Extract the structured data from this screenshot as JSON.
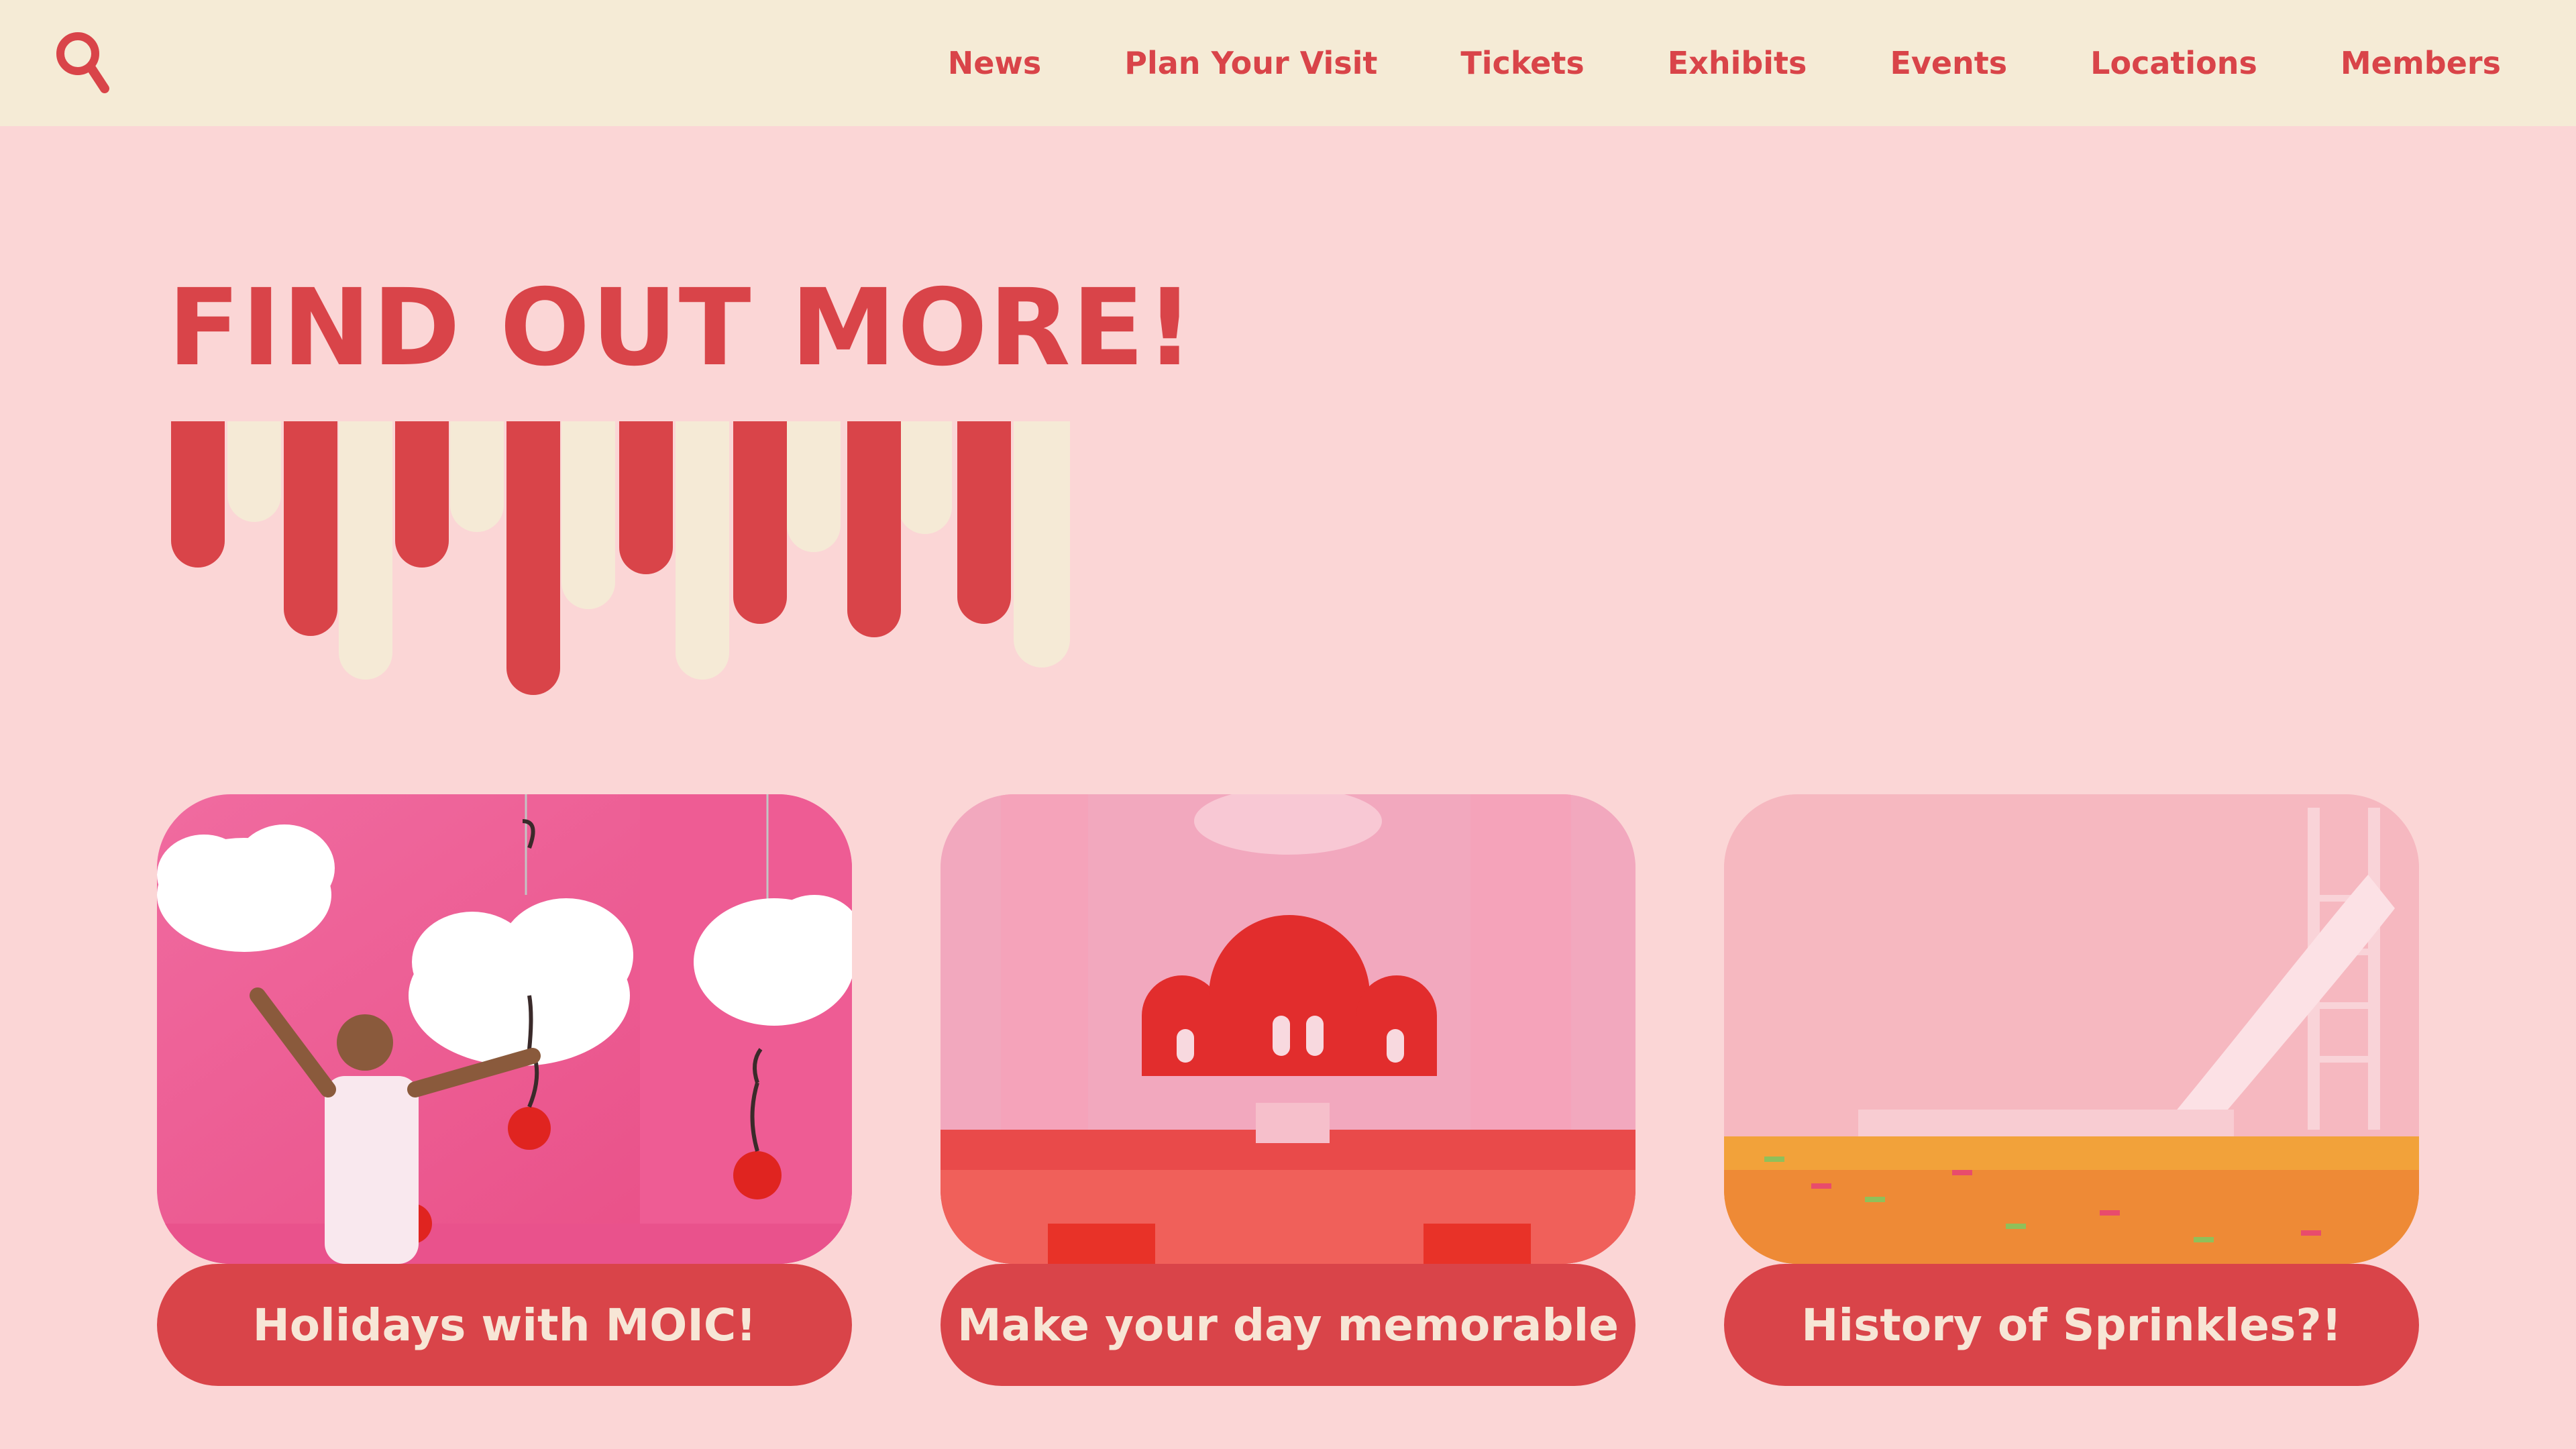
{
  "header": {
    "search_icon": "search-icon",
    "nav": [
      {
        "label": "News"
      },
      {
        "label": "Plan Your Visit"
      },
      {
        "label": "Tickets"
      },
      {
        "label": "Exhibits"
      },
      {
        "label": "Events"
      },
      {
        "label": "Locations"
      },
      {
        "label": "Members"
      }
    ]
  },
  "hero": {
    "title": "FIND OUT MORE!"
  },
  "cards": [
    {
      "label": "Holidays with MOIC!",
      "image": "clouds-cherries-photo"
    },
    {
      "label": "Make your day memorable",
      "image": "sprinkle-pool-room-photo"
    },
    {
      "label": "History of Sprinkles?!",
      "image": "sprinkle-slide-photo"
    }
  ],
  "colors": {
    "accent": "#D94449",
    "header_bg": "#F5EBD6",
    "page_bg": "#FBD6D6",
    "cream": "#F5EAD6"
  }
}
